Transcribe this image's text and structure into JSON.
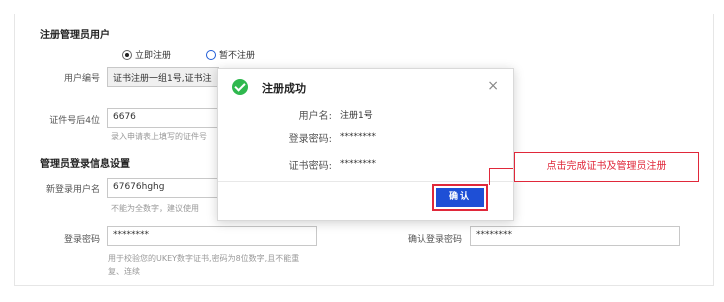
{
  "form": {
    "section_admin": "注册管理员用户",
    "radio_now": "立即注册",
    "radio_later": "暂不注册",
    "user_no_label": "用户编号",
    "user_no_value": "证书注册一组1号,证书注",
    "cert_last4_label": "证件号后4位",
    "cert_last4_value": "6676",
    "cert_hint": "录入申请表上填写的证件号",
    "section_login": "管理员登录信息设置",
    "new_login_label": "新登录用户名",
    "new_login_value": "67676hghg",
    "new_login_hint": "不能为全数字，建议使用",
    "login_pwd_label": "登录密码",
    "login_pwd_value": "********",
    "confirm_pwd_label": "确认登录密码",
    "confirm_pwd_value": "********",
    "pwd_hint_line1": "用于校验您的UKEY数字证书,密码为8位数字,且不能重",
    "pwd_hint_line2": "复、连续"
  },
  "modal": {
    "title": "注册成功",
    "close_glyph": "×",
    "username_label": "用户名:",
    "username_value": "注册1号",
    "login_pwd_label": "登录密码:",
    "login_pwd_value": "********",
    "cert_pwd_label": "证书密码:",
    "cert_pwd_value": "********",
    "confirm_label": "确认"
  },
  "callout": {
    "text": "点击完成证书及管理员注册"
  },
  "colors": {
    "accent_red": "#e0283a",
    "button_blue": "#1e4fd6",
    "success_green": "#2fb84e"
  }
}
